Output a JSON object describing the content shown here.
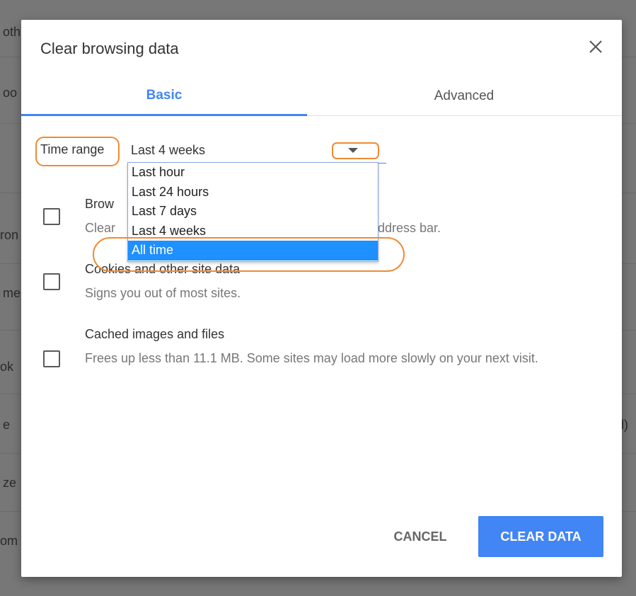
{
  "background": {
    "fragments": [
      "oth",
      "oo",
      "ron",
      "me",
      "ok",
      "e",
      "ze",
      "om",
      "d)"
    ]
  },
  "dialog": {
    "title": "Clear browsing data",
    "close_icon": "close-icon",
    "tabs": [
      {
        "label": "Basic",
        "active": true
      },
      {
        "label": "Advanced",
        "active": false
      }
    ],
    "time_range": {
      "label": "Time range",
      "selected": "Last 4 weeks",
      "options": [
        "Last hour",
        "Last 24 hours",
        "Last 7 days",
        "Last 4 weeks",
        "All time"
      ],
      "highlighted": "All time"
    },
    "items": [
      {
        "title": "Brow",
        "description_start": "Clear",
        "description_end": "ddress bar.",
        "checked": false
      },
      {
        "title": "Cookies and other site data",
        "description": "Signs you out of most sites.",
        "checked": false
      },
      {
        "title": "Cached images and files",
        "description": "Frees up less than 11.1 MB. Some sites may load more slowly on your next visit.",
        "checked": false
      }
    ],
    "buttons": {
      "cancel": "CANCEL",
      "clear": "CLEAR DATA"
    }
  },
  "colors": {
    "accent": "#4285f4",
    "selected_option": "#1e90ff",
    "annotation": "#f08a35"
  }
}
